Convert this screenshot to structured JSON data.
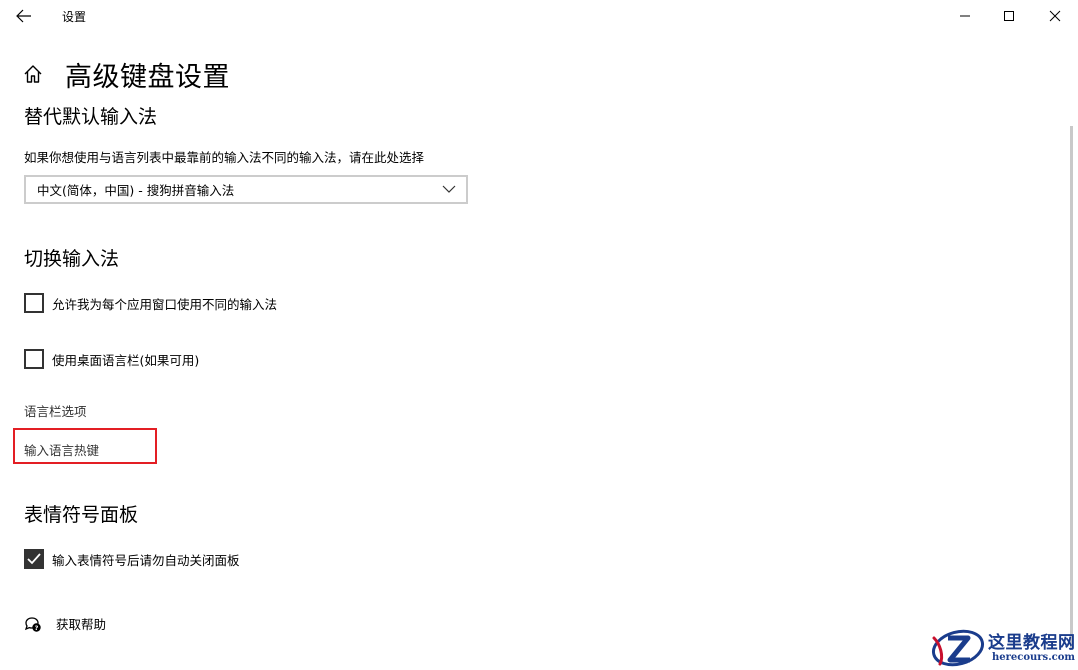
{
  "window": {
    "title": "设置",
    "icons": {
      "back": "arrow-left-icon",
      "minimize": "minimize-icon",
      "maximize": "maximize-icon",
      "close": "close-icon"
    }
  },
  "page": {
    "title": "高级键盘设置",
    "icon": "home-icon"
  },
  "override_input": {
    "heading": "替代默认输入法",
    "description": "如果你想使用与语言列表中最靠前的输入法不同的输入法，请在此处选择",
    "dropdown_value": "中文(简体，中国) - 搜狗拼音输入法"
  },
  "switch_input": {
    "heading": "切换输入法",
    "options": [
      {
        "label": "允许我为每个应用窗口使用不同的输入法",
        "checked": false
      },
      {
        "label": "使用桌面语言栏(如果可用)",
        "checked": false
      }
    ],
    "links": {
      "language_bar_options": "语言栏选项",
      "input_hotkeys": "输入语言热键"
    }
  },
  "emoji_panel": {
    "heading": "表情符号面板",
    "options": [
      {
        "label": "输入表情符号后请勿自动关闭面板",
        "checked": true
      }
    ]
  },
  "help": {
    "label": "获取帮助",
    "icon": "help-chat-icon"
  },
  "watermark": {
    "title": "这里教程网",
    "subtitle": "herecours.com"
  },
  "colors": {
    "highlight": "#e31e24",
    "checkbox": "#333333",
    "watermark": "#1a3c8c"
  }
}
